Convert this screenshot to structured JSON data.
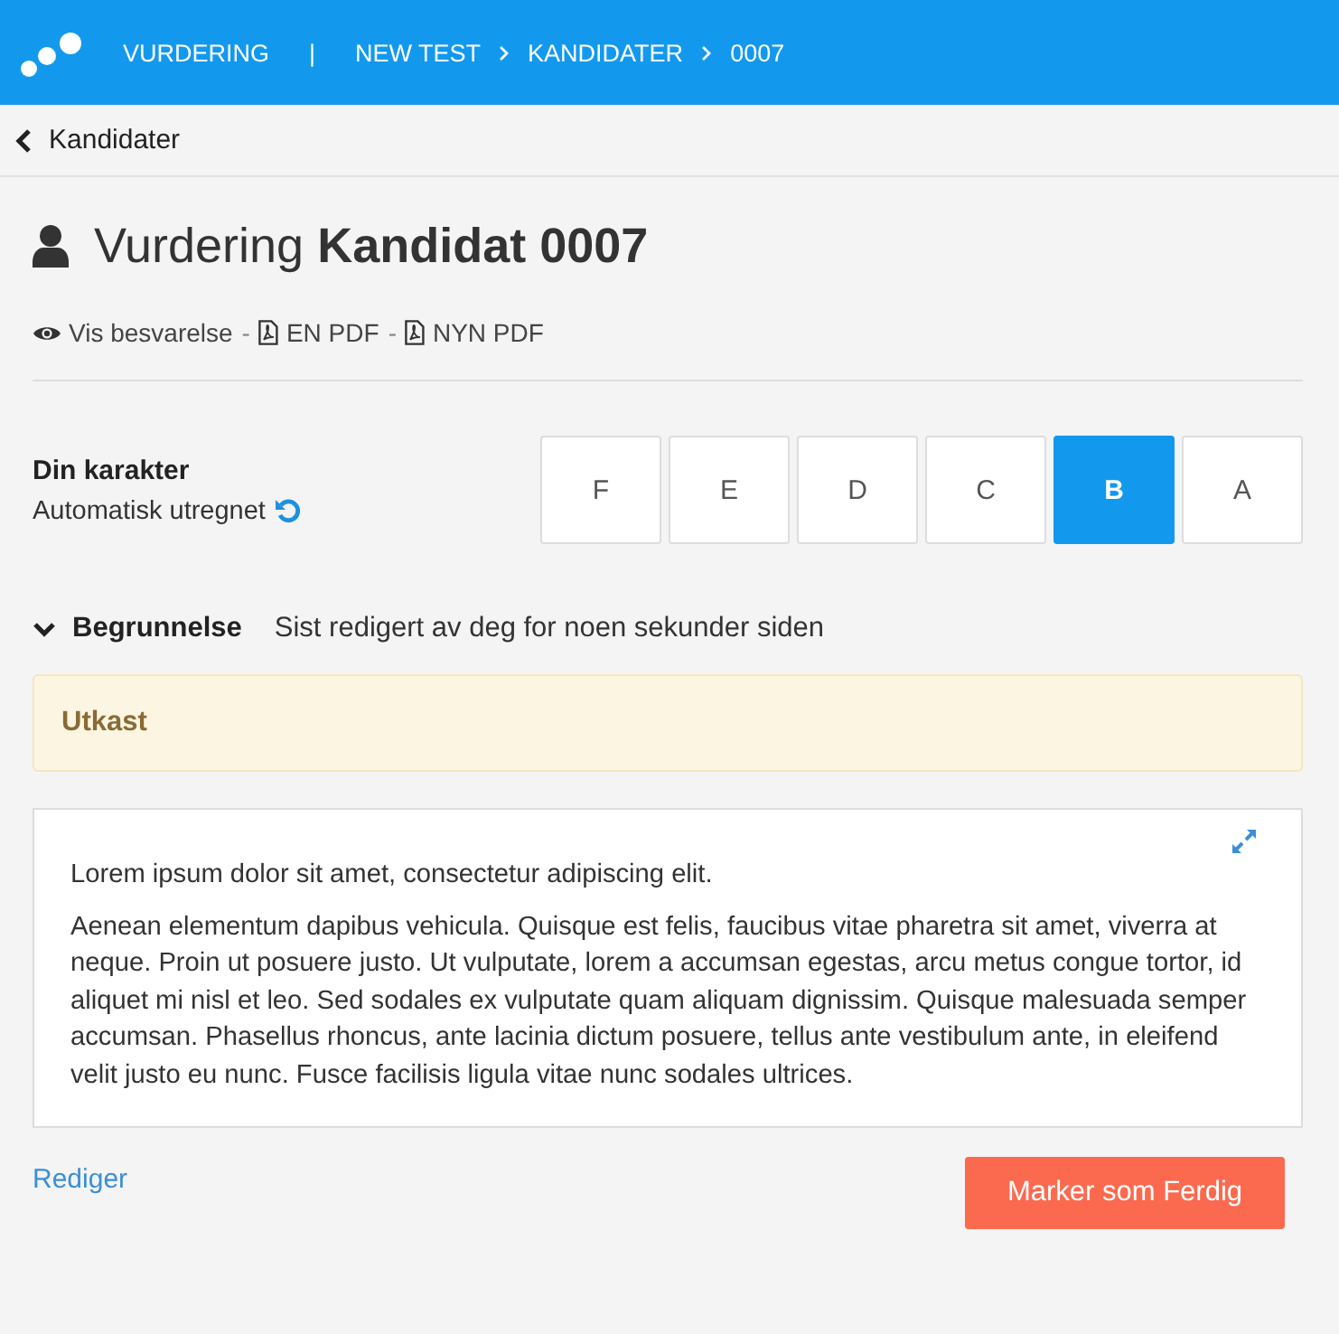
{
  "header": {
    "app": "VURDERING",
    "divider": "|",
    "crumbs": [
      "NEW TEST",
      "KANDIDATER",
      "0007"
    ]
  },
  "back": {
    "label": "Kandidater"
  },
  "title": {
    "prefix": "Vurdering",
    "name": "Kandidat 0007"
  },
  "links": [
    {
      "kind": "view",
      "label": "Vis besvarelse"
    },
    {
      "kind": "pdf",
      "label": "EN PDF"
    },
    {
      "kind": "pdf",
      "label": "NYN PDF"
    }
  ],
  "link_separator": "-",
  "grade": {
    "label": "Din karakter",
    "sub": "Automatisk utregnet",
    "options": [
      {
        "label": "F",
        "selected": false
      },
      {
        "label": "E",
        "selected": false
      },
      {
        "label": "D",
        "selected": false
      },
      {
        "label": "C",
        "selected": false
      },
      {
        "label": "B",
        "selected": true
      },
      {
        "label": "A",
        "selected": false
      }
    ]
  },
  "section": {
    "title": "Begrunnelse",
    "expanded": true,
    "note": "Sist redigert av deg for noen sekunder siden"
  },
  "status": "Utkast",
  "text": [
    "Lorem ipsum dolor sit amet, consectetur adipiscing elit.",
    "Aenean elementum dapibus vehicula. Quisque est felis, faucibus vitae pharetra sit amet, viverra at neque. Proin ut posuere justo. Ut vulputate, lorem a accumsan egestas, arcu metus congue tortor, id aliquet mi nisl et leo. Sed sodales ex vulputate quam aliquam dignissim. Quisque malesuada semper accumsan. Phasellus rhoncus, ante lacinia dictum posuere, tellus ante vestibulum ante, in eleifend velit justo eu nunc. Fusce facilisis ligula vitae nunc sodales ultrices."
  ],
  "edit_link": "Rediger",
  "finish_button": "Marker som Ferdig"
}
